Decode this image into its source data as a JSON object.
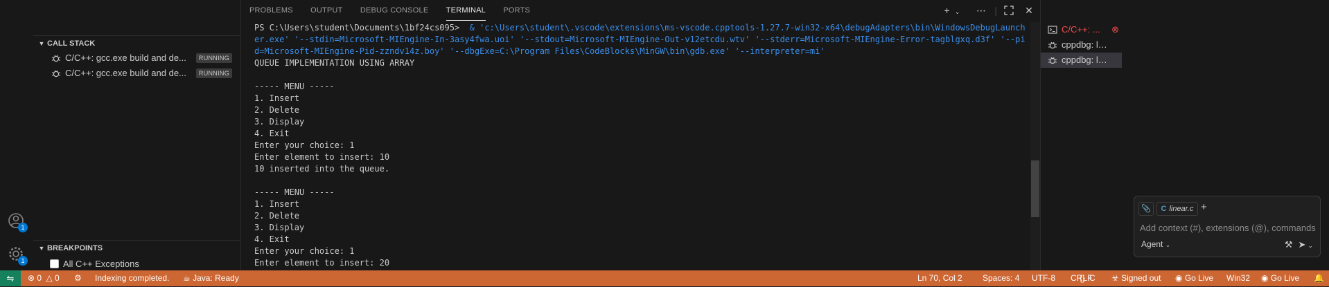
{
  "activity": {
    "accounts_badge": "1",
    "manage_badge": "1"
  },
  "sidebar": {
    "call_stack": {
      "title": "CALL STACK",
      "items": [
        {
          "label": "C/C++: gcc.exe build and de...",
          "status": "RUNNING"
        },
        {
          "label": "C/C++: gcc.exe build and de...",
          "status": "RUNNING"
        }
      ]
    },
    "breakpoints": {
      "title": "BREAKPOINTS",
      "items": [
        {
          "label": "All C++ Exceptions"
        }
      ]
    }
  },
  "panel": {
    "tabs": [
      "PROBLEMS",
      "OUTPUT",
      "DEBUG CONSOLE",
      "TERMINAL",
      "PORTS"
    ],
    "active_tab": "TERMINAL",
    "terminal": {
      "prompt": "PS C:\\Users\\student\\Documents\\1bf24cs095> ",
      "command": " & 'c:\\Users\\student\\.vscode\\extensions\\ms-vscode.cpptools-1.27.7-win32-x64\\debugAdapters\\bin\\WindowsDebugLauncher.exe' '--stdin=Microsoft-MIEngine-In-3asy4fwa.uoi' '--stdout=Microsoft-MIEngine-Out-v12etcdu.wtv' '--stderr=Microsoft-MIEngine-Error-tagblgxq.d3f' '--pid=Microsoft-MIEngine-Pid-zzndv14z.boy' '--dbgExe=C:\\Program Files\\CodeBlocks\\MinGW\\bin\\gdb.exe' '--interpreter=mi'",
      "lines": [
        "QUEUE IMPLEMENTATION USING ARRAY",
        "",
        "----- MENU -----",
        "1. Insert",
        "2. Delete",
        "3. Display",
        "4. Exit",
        "Enter your choice: 1",
        "Enter element to insert: 10",
        "10 inserted into the queue.",
        "",
        "----- MENU -----",
        "1. Insert",
        "2. Delete",
        "3. Display",
        "4. Exit",
        "Enter your choice: 1",
        "Enter element to insert: 20"
      ]
    }
  },
  "terminals_list": [
    {
      "label": "C/C++: ...",
      "color": "#f14c4c"
    },
    {
      "label": "cppdbg: lin...",
      "color": "#cccccc"
    },
    {
      "label": "cppdbg: lin...",
      "color": "#cccccc"
    }
  ],
  "chat": {
    "attachment_chip": "linear.c",
    "placeholder": "Add context (#), extensions (@), commands (/)",
    "mode": "Agent"
  },
  "status_bar": {
    "errors": "0",
    "warnings": "0",
    "indexing": "Indexing completed.",
    "java": "Java: Ready",
    "position": "Ln 70, Col 2",
    "spaces": "Spaces: 4",
    "encoding": "UTF-8",
    "eol": "CRLF",
    "language": "C",
    "account": "Signed out",
    "go_live_1": "Go Live",
    "platform": "Win32",
    "go_live_2": "Go Live"
  },
  "colors": {
    "status_bar": "#cc6633",
    "remote_indicator": "#16825d",
    "command_text": "#3b8eea",
    "editor_bg": "#181818"
  }
}
